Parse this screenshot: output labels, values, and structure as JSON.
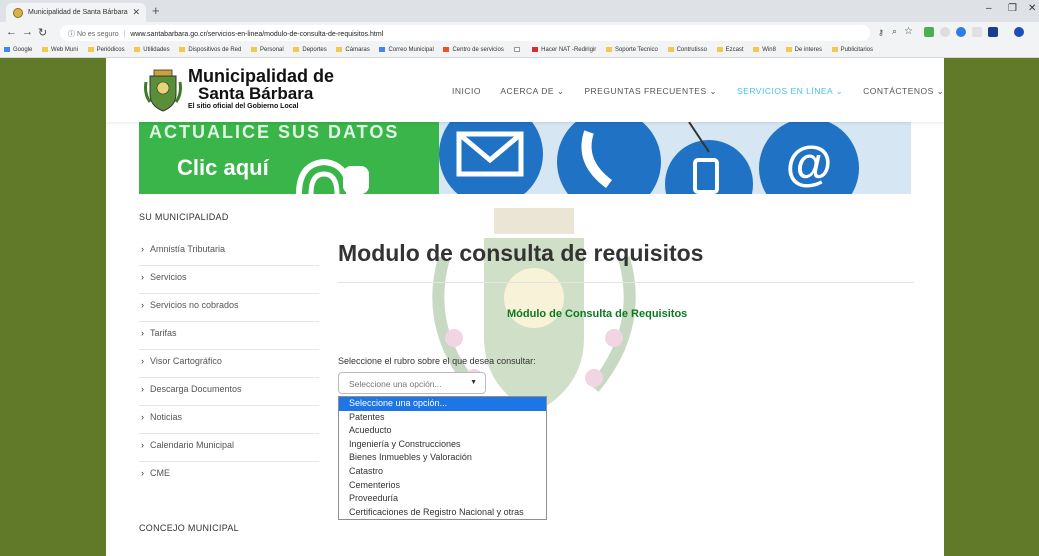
{
  "browser": {
    "tab_title": "Municipalidad de Santa Bárbara",
    "new_tab": "+",
    "secure_text": "No es seguro",
    "url": "www.santabarbara.go.cr/servicios-en-linea/modulo-de-consulta-de-requisitos.html",
    "bookmarks": [
      {
        "label": "Google",
        "type": "g"
      },
      {
        "label": "Web Muni"
      },
      {
        "label": "Periódicos"
      },
      {
        "label": "Utilidades"
      },
      {
        "label": "Dispositivos de Red"
      },
      {
        "label": "Personal"
      },
      {
        "label": "Deportes"
      },
      {
        "label": "Cámaras"
      },
      {
        "label": "Correo Municipal",
        "type": "g"
      },
      {
        "label": "Centro de servicios",
        "type": "ms"
      },
      {
        "label": ""
      },
      {
        "label": "Hacer NAT -Redirigir",
        "type": "gm"
      },
      {
        "label": "Soporte Tecnico"
      },
      {
        "label": "Contrutisso"
      },
      {
        "label": "Ezcast"
      },
      {
        "label": "Win8"
      },
      {
        "label": "De interes"
      },
      {
        "label": "Publicitarios"
      }
    ]
  },
  "site": {
    "logo": {
      "line1": "Municipalidad de",
      "line2": "Santa Bárbara",
      "tagline": "El sitio oficial del Gobierno Local"
    },
    "nav": [
      {
        "label": "INICIO",
        "active": false
      },
      {
        "label": "ACERCA DE ⌄",
        "active": false
      },
      {
        "label": "PREGUNTAS FRECUENTES ⌄",
        "active": false
      },
      {
        "label": "SERVICIOS EN LÍNEA ⌄",
        "active": true
      },
      {
        "label": "CONTÁCTENOS ⌄",
        "active": false
      }
    ],
    "banner": {
      "top_text": "ACTUALICE SUS DATOS",
      "cta": "Clic aquí"
    },
    "sidebar": {
      "title": "SU MUNICIPALIDAD",
      "items": [
        "Amnistía Tributaria",
        "Servicios",
        "Servicios no cobrados",
        "Tarifas",
        "Visor Cartográfico",
        "Descarga Documentos",
        "Noticias",
        "Calendario Municipal",
        "CME"
      ],
      "section2_title": "CONCEJO MUNICIPAL"
    },
    "main": {
      "title": "Modulo de consulta de requisitos",
      "subtitle": "Módulo de Consulta de Requisitos",
      "select_label": "Seleccione el rubro sobre el que desea consultar:",
      "select_value": "Seleccione una opción...",
      "options": [
        "Seleccione una opción...",
        "Patentes",
        "Acueducto",
        "Ingeniería y Construcciones",
        "Bienes Inmuebles y Valoración",
        "Catastro",
        "Cementerios",
        "Proveeduría",
        "Certificaciones de Registro Nacional y otras"
      ]
    }
  },
  "colors": {
    "page_bg": "#607a2a",
    "active_nav": "#48c4e8",
    "subtitle": "#0a7a1e",
    "dropdown_selected": "#1e75e6",
    "banner_green": "#39b54a"
  }
}
